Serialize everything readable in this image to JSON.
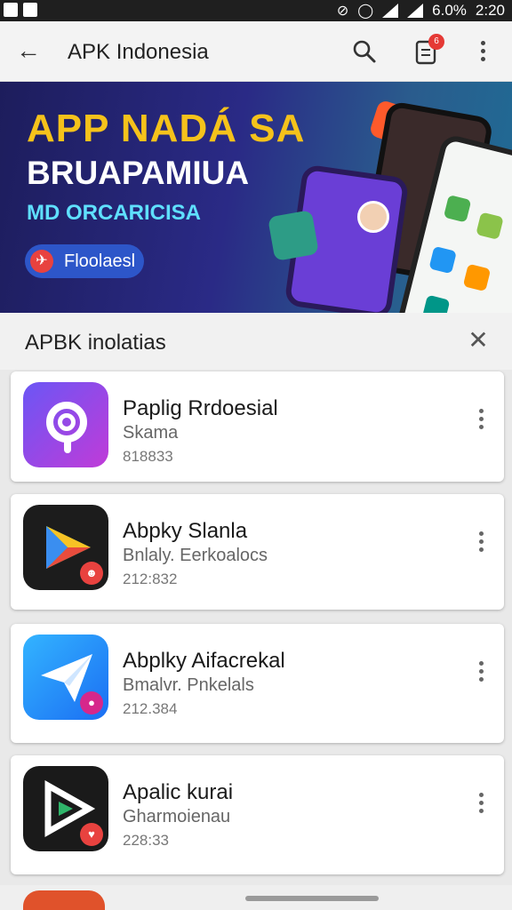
{
  "status_bar": {
    "battery": "6.0%",
    "time": "2:20"
  },
  "app_bar": {
    "title": "APK Indonesia",
    "notification_count": "6"
  },
  "banner": {
    "line1": "APP NADÁ SA",
    "line2": "BRUAPAMIUA",
    "line3": "MD ORCARICISA",
    "button_label": "Floolaesl"
  },
  "section": {
    "title": "APBK inolatias"
  },
  "apps": [
    {
      "name": "Paplig Rrdoesial",
      "subtitle": "Skama",
      "meta": "818833",
      "icon": "purple-circle-icon"
    },
    {
      "name": "Abpky Slanla",
      "subtitle": "Bnlaly. Eerkoalocs",
      "meta": "212:832",
      "icon": "play-triangle-icon"
    },
    {
      "name": "Abplky Aifacrekal",
      "subtitle": "Bmalvr. Pnkelals",
      "meta": "212.384",
      "icon": "paper-plane-icon"
    },
    {
      "name": "Apalic kurai",
      "subtitle": "Gharmoienau",
      "meta": "228:33",
      "icon": "play-arrow-icon"
    }
  ],
  "colors": {
    "accent_red": "#e53935",
    "banner_yellow": "#f5c21b"
  }
}
